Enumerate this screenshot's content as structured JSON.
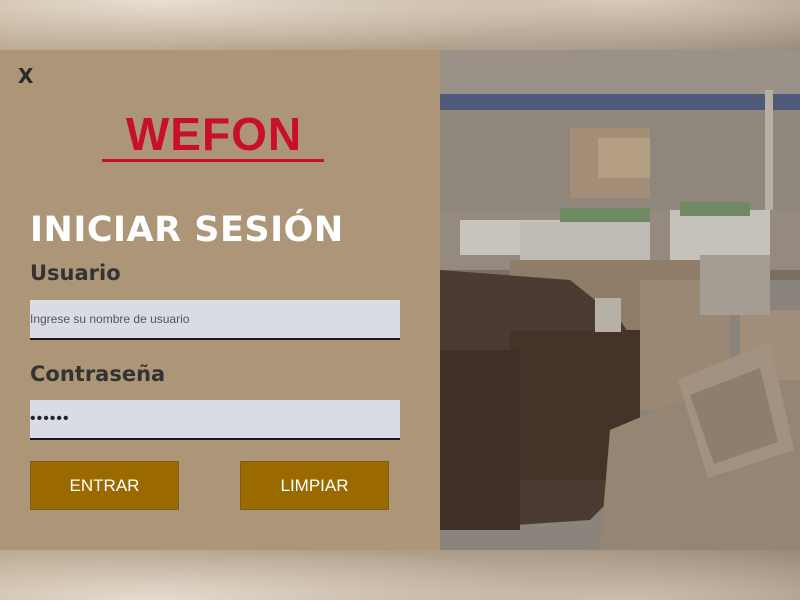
{
  "dialog": {
    "close_label": "X",
    "logo_text": "WEFON",
    "title": "INICIAR SESIÓN",
    "username": {
      "label": "Usuario",
      "placeholder": "Ingrese su nombre de usuario",
      "value": ""
    },
    "password": {
      "label": "Contraseña",
      "value": "••••••"
    },
    "buttons": {
      "enter": "ENTRAR",
      "clear": "LIMPIAR"
    }
  },
  "colors": {
    "panel": "#ad9677",
    "logo": "#c8102e",
    "button": "#9a6a00",
    "input": "#d9dce4"
  },
  "image": {
    "subject": "furniture-showroom-photo"
  }
}
